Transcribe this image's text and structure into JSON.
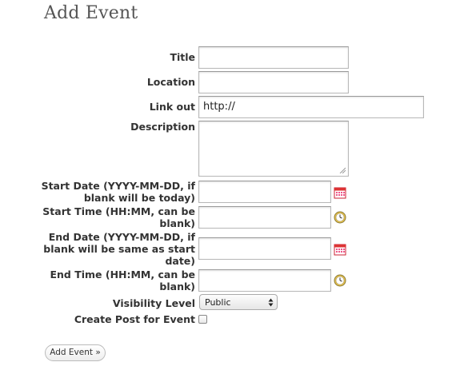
{
  "page_title": "Add Event",
  "fields": {
    "title": {
      "label": "Title",
      "value": ""
    },
    "location": {
      "label": "Location",
      "value": ""
    },
    "link_out": {
      "label": "Link out",
      "value": "http://"
    },
    "description": {
      "label": "Description",
      "value": ""
    },
    "start_date": {
      "label_lines": [
        "Start Date (YYYY-MM-DD, if",
        "blank will be today)"
      ],
      "value": ""
    },
    "start_time": {
      "label_lines": [
        "Start Time (HH:MM, can be",
        "blank)"
      ],
      "value": ""
    },
    "end_date": {
      "label_lines": [
        "End Date (YYYY-MM-DD, if",
        "blank will be same as start",
        "date)"
      ],
      "value": ""
    },
    "end_time": {
      "label_lines": [
        "End Time (HH:MM, can be",
        "blank)"
      ],
      "value": ""
    },
    "visibility": {
      "label": "Visibility Level",
      "selected": "Public"
    },
    "create_post": {
      "label": "Create Post for Event",
      "checked": false
    }
  },
  "submit_label": "Add Event »",
  "icons": {
    "date": "calendar-icon",
    "time": "clock-icon"
  }
}
